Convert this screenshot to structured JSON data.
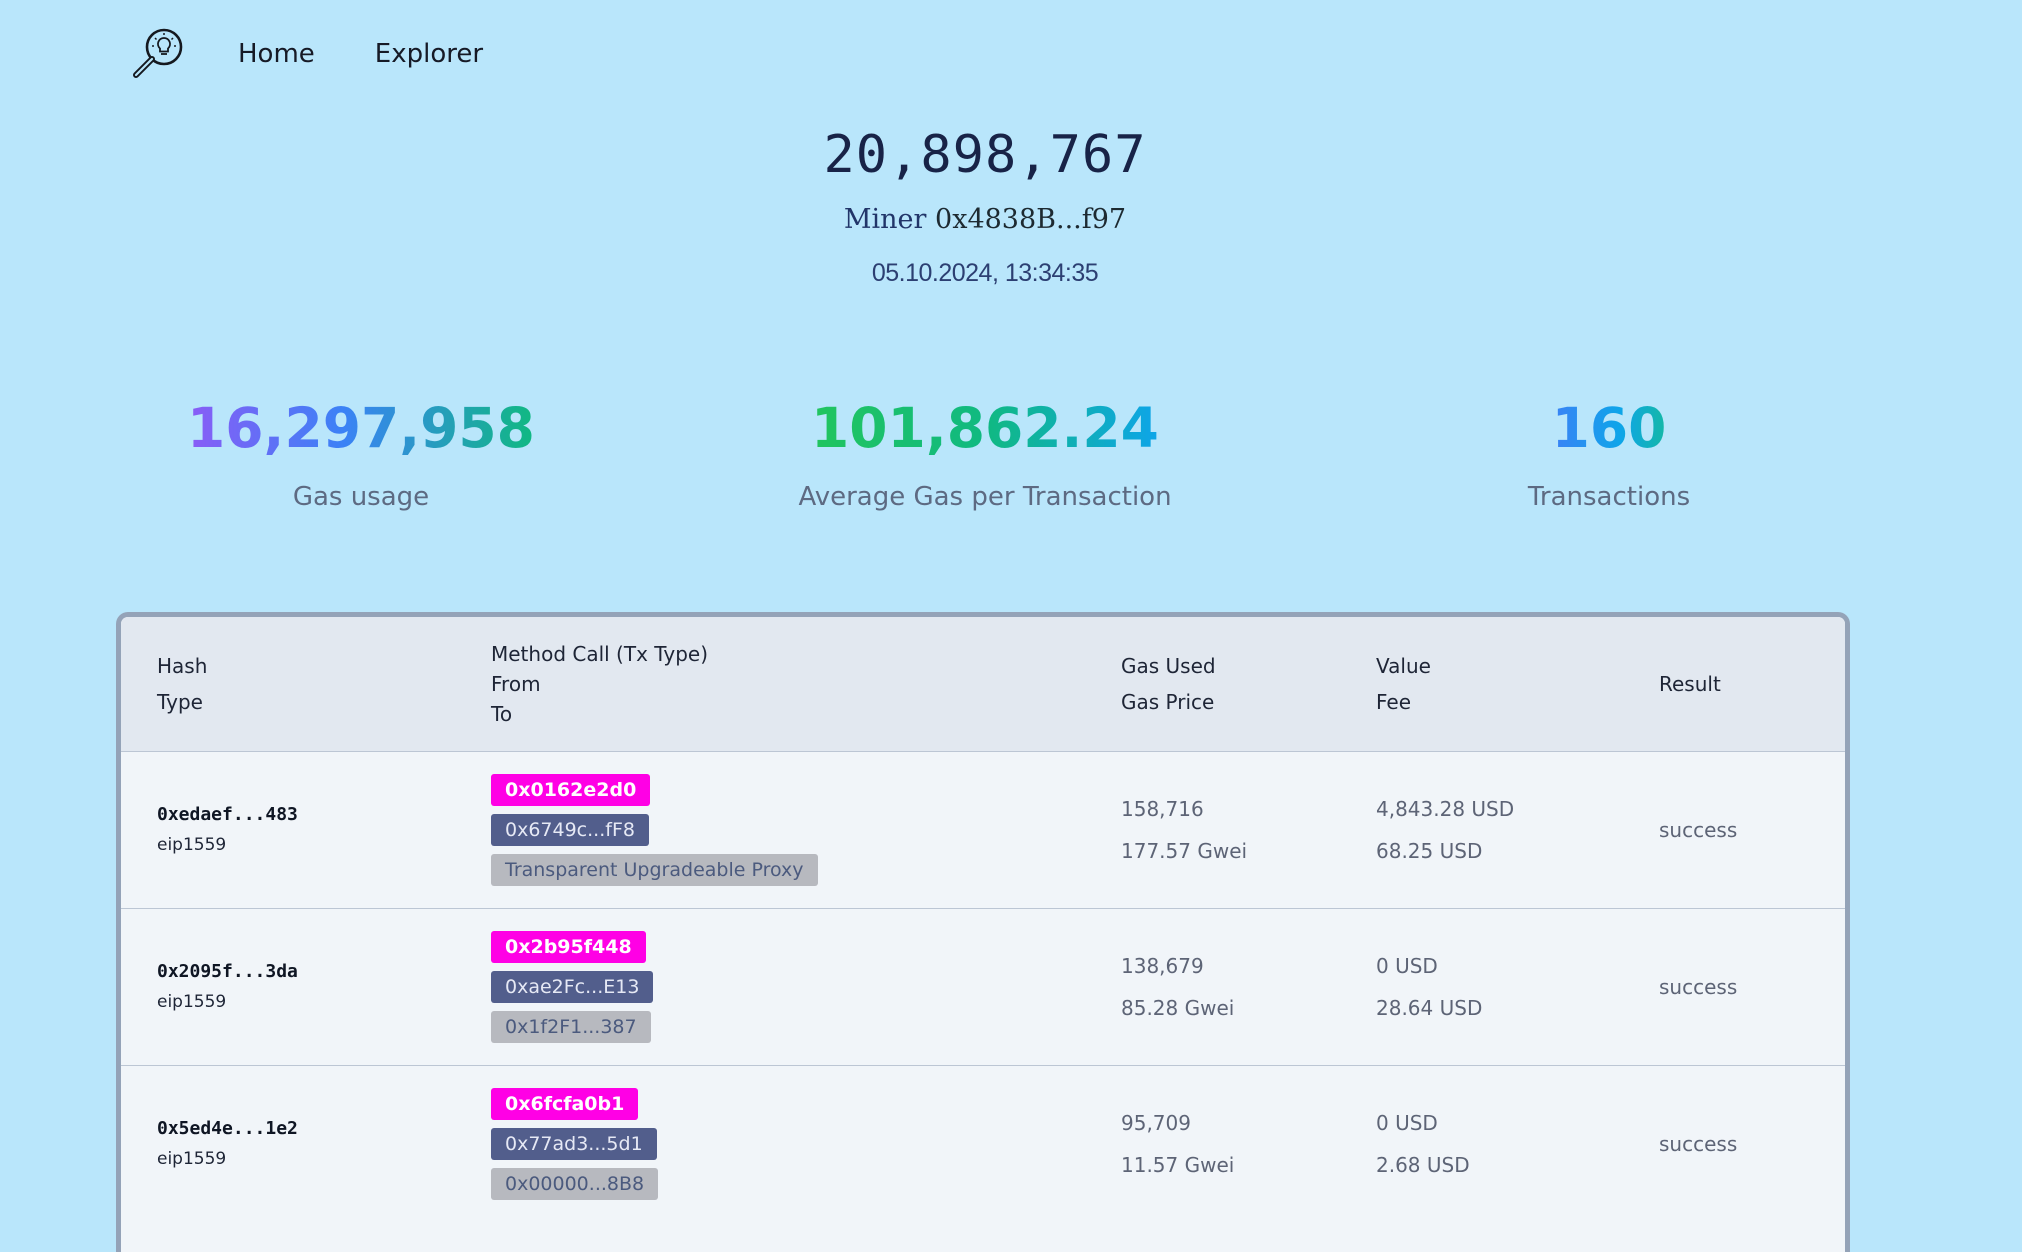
{
  "nav": {
    "logo_icon": "magnifier-lightbulb-icon",
    "links": [
      "Home",
      "Explorer"
    ]
  },
  "block": {
    "number": "20,898,767",
    "miner_label": "Miner",
    "miner_address": "0x4838B...f97",
    "timestamp": "05.10.2024, 13:34:35"
  },
  "stats": [
    {
      "value": "16,297,958",
      "label": "Gas usage"
    },
    {
      "value": "101,862.24",
      "label": "Average Gas per Transaction"
    },
    {
      "value": "160",
      "label": "Transactions"
    }
  ],
  "table": {
    "headers": {
      "hash": [
        "Hash",
        "Type"
      ],
      "method": [
        "Method Call (Tx Type)",
        "From",
        "To"
      ],
      "gas": [
        "Gas Used",
        "Gas Price"
      ],
      "value": [
        "Value",
        "Fee"
      ],
      "result": "Result"
    },
    "rows": [
      {
        "hash": "0xedaef...483",
        "type": "eip1559",
        "method": "0x0162e2d0",
        "from": "0x6749c...fF8",
        "to": "Transparent Upgradeable Proxy",
        "gas_used": "158,716",
        "gas_price": "177.57 Gwei",
        "value": "4,843.28 USD",
        "fee": "68.25 USD",
        "result": "success"
      },
      {
        "hash": "0x2095f...3da",
        "type": "eip1559",
        "method": "0x2b95f448",
        "from": "0xae2Fc...E13",
        "to": "0x1f2F1...387",
        "gas_used": "138,679",
        "gas_price": "85.28 Gwei",
        "value": "0 USD",
        "fee": "28.64 USD",
        "result": "success"
      },
      {
        "hash": "0x5ed4e...1e2",
        "type": "eip1559",
        "method": "0x6fcfa0b1",
        "from": "0x77ad3...5d1",
        "to": "0x00000...8B8",
        "gas_used": "95,709",
        "gas_price": "11.57 Gwei",
        "value": "0 USD",
        "fee": "2.68 USD",
        "result": "success"
      }
    ]
  },
  "colors": {
    "background": "#b9e6fb",
    "method_badge": "#ff00e5",
    "from_badge": "#525e8c",
    "to_badge": "#b7b9bf",
    "table_header": "#e2e8f0",
    "table_body": "#f1f5f9"
  }
}
